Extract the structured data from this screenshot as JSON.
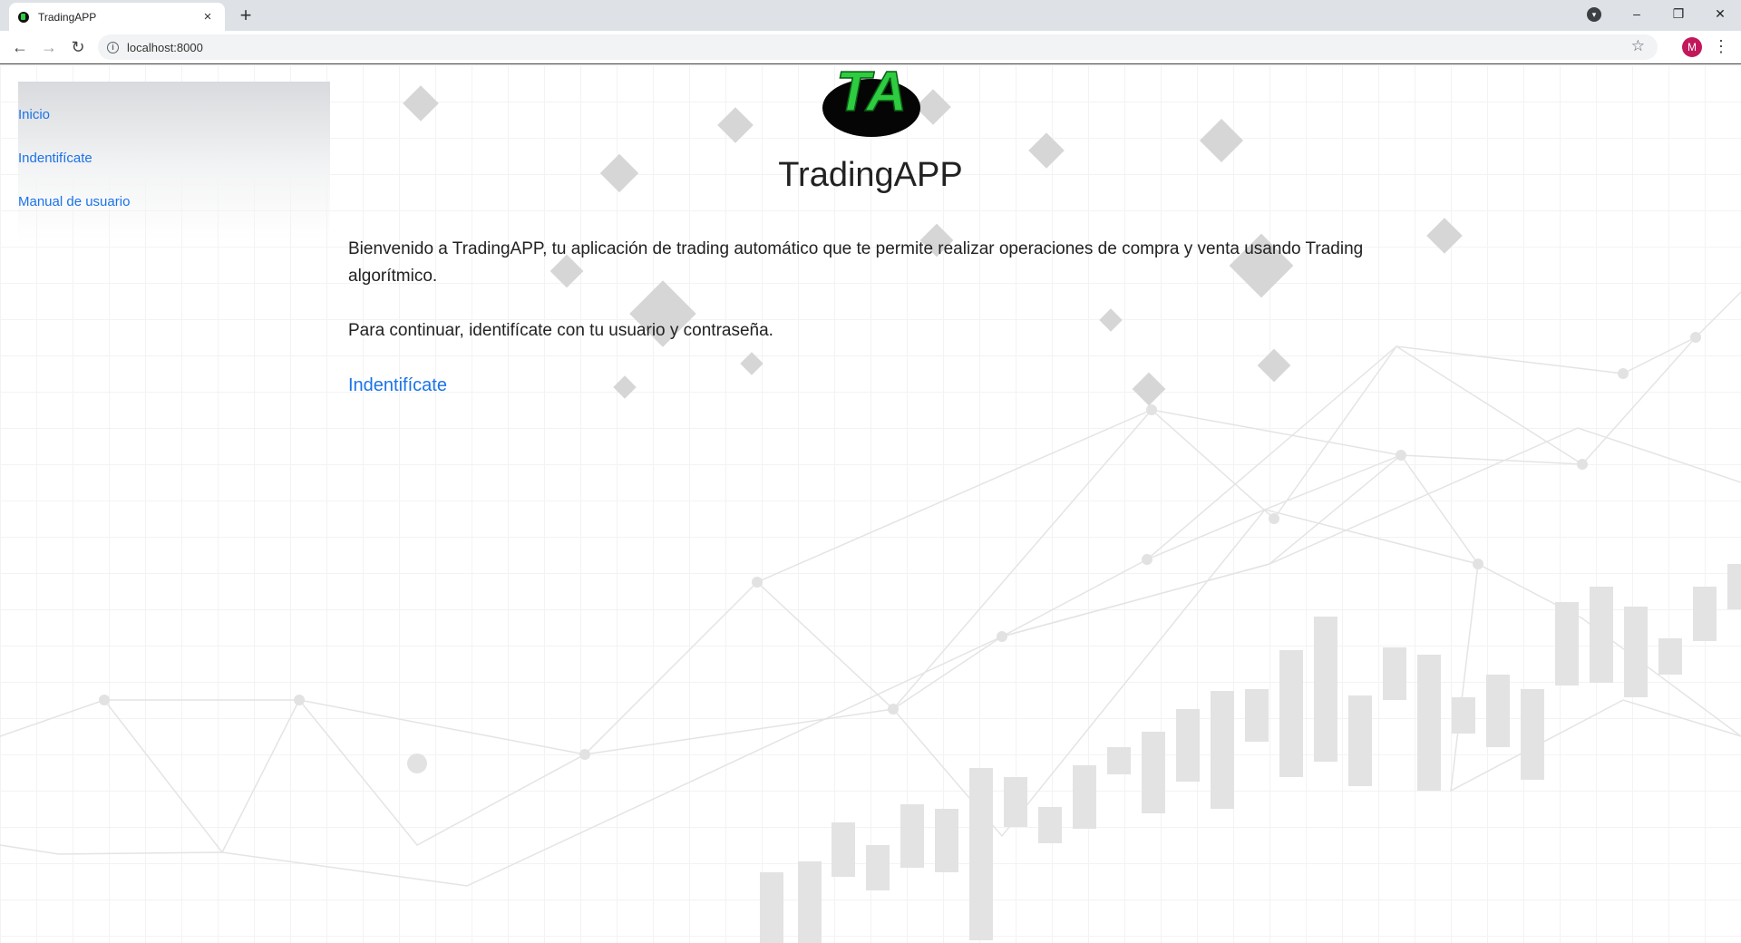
{
  "browser": {
    "tab_title": "TradingAPP",
    "tab_close": "×",
    "new_tab": "+",
    "url": "localhost:8000",
    "profile_initial": "M",
    "window_controls": {
      "minimize": "–",
      "restore": "❐",
      "close": "✕"
    },
    "icons": [
      "back-arrow-icon",
      "forward-arrow-icon",
      "reload-icon",
      "info-icon",
      "star-icon",
      "menu-dots-icon"
    ]
  },
  "sidebar": {
    "items": [
      {
        "label": "Inicio"
      },
      {
        "label": "Indentifícate"
      },
      {
        "label": "Manual de usuario"
      }
    ]
  },
  "main": {
    "logo_text": "TA",
    "title": "TradingAPP",
    "intro": "Bienvenido a TradingAPP, tu aplicación de trading automático que te permite realizar operaciones de compra y venta usando Trading algorítmico.",
    "instruction": "Para continuar, identifícate con tu usuario y contraseña.",
    "login_link": "Indentifícate"
  },
  "colors": {
    "link": "#1a73e8",
    "logo_green": "#2ecc40",
    "text": "#222222",
    "chrome_bg": "#dee1e6"
  }
}
